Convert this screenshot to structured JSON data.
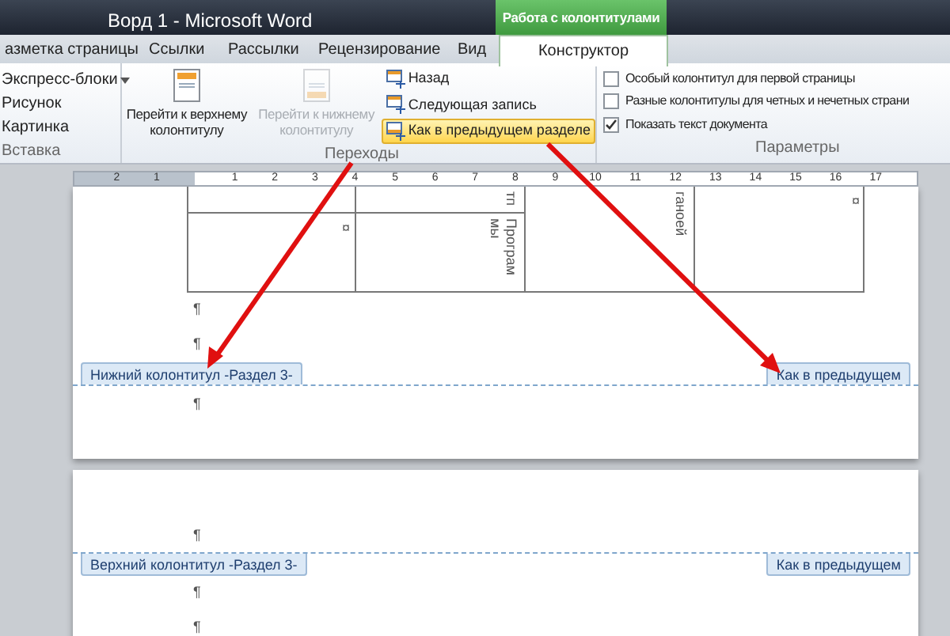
{
  "window": {
    "title": "Ворд 1 - Microsoft Word"
  },
  "context_tab_group": "Работа с колонтитулами",
  "tabs": [
    {
      "label": "азметка страницы",
      "selected": false
    },
    {
      "label": "Ссылки",
      "selected": false
    },
    {
      "label": "Рассылки",
      "selected": false
    },
    {
      "label": "Рецензирование",
      "selected": false
    },
    {
      "label": "Вид",
      "selected": false
    },
    {
      "label": "Конструктор",
      "selected": true
    }
  ],
  "insert_group": {
    "label": "Вставка",
    "items": [
      {
        "label": "Экспресс-блоки",
        "kind": "menu"
      },
      {
        "label": "Рисунок",
        "kind": "picture"
      },
      {
        "label": "Картинка",
        "kind": "clip"
      }
    ]
  },
  "navigation_group": {
    "label": "Переходы",
    "large_buttons": [
      {
        "label": "Перейти к верхнему колонтитулу",
        "disabled": false
      },
      {
        "label": "Перейти к нижнему колонтитулу",
        "disabled": true
      }
    ],
    "small_buttons": [
      {
        "label": "Назад",
        "highlighted": false
      },
      {
        "label": "Следующая запись",
        "highlighted": false
      },
      {
        "label": "Как в предыдущем разделе",
        "highlighted": true
      }
    ]
  },
  "options_group": {
    "label": "Параметры",
    "checkboxes": [
      {
        "label": "Особый колонтитул для первой страницы",
        "checked": false
      },
      {
        "label": "Разные колонтитулы для четных и нечетных страни",
        "checked": false
      },
      {
        "label": "Показать текст документа",
        "checked": true
      }
    ]
  },
  "ruler": {
    "left_labels": [
      "2",
      "1"
    ],
    "labels": [
      "1",
      "2",
      "3",
      "4",
      "5",
      "6",
      "7",
      "8",
      "9",
      "10",
      "11",
      "12",
      "13",
      "14",
      "15",
      "16",
      "17"
    ]
  },
  "pages": [
    {
      "table": {
        "row_1": {
          "column_2": "тп"
        },
        "row_2": {
          "column_1": "¤",
          "column_2": "Програм мы"
        },
        "column_3": "ганоей",
        "column_4": "¤"
      },
      "marks_before": [
        "¶",
        "¶"
      ],
      "band": {
        "kind": "footer",
        "label": "Нижний колонтитул -Раздел 3-",
        "link_label": "Как в предыдущем"
      },
      "marks_after": [
        "¶"
      ]
    },
    {
      "marks_before": [
        "¶"
      ],
      "band": {
        "kind": "header",
        "label": "Верхний колонтитул -Раздел 3-",
        "link_label": "Как в предыдущем"
      },
      "marks_after": [
        "¶",
        "¶"
      ]
    }
  ]
}
